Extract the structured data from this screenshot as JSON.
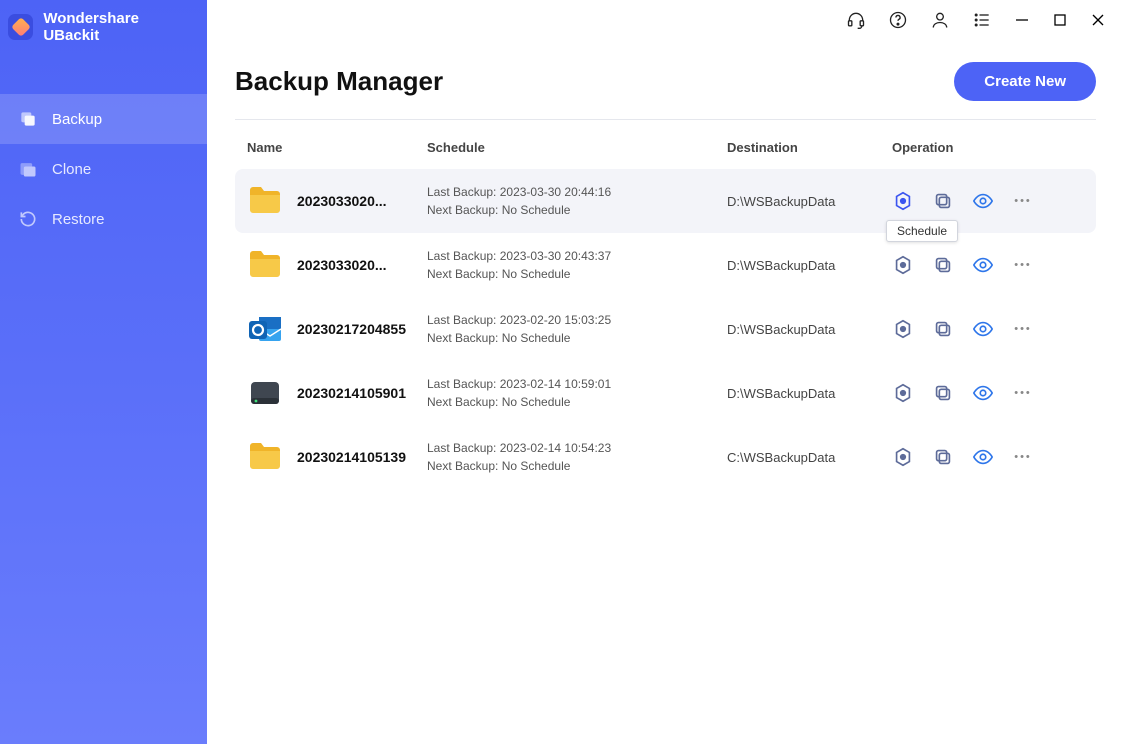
{
  "app": {
    "title": "Wondershare UBackit"
  },
  "sidebar": {
    "items": [
      {
        "label": "Backup",
        "icon": "backup-icon",
        "active": true
      },
      {
        "label": "Clone",
        "icon": "clone-icon",
        "active": false
      },
      {
        "label": "Restore",
        "icon": "restore-icon",
        "active": false
      }
    ]
  },
  "titlebar": {
    "icons": [
      "headset-icon",
      "help-icon",
      "user-icon",
      "menu-icon"
    ],
    "window": [
      "minimize",
      "maximize",
      "close"
    ]
  },
  "main": {
    "title": "Backup Manager",
    "create_label": "Create New",
    "columns": {
      "name": "Name",
      "schedule": "Schedule",
      "destination": "Destination",
      "operation": "Operation"
    },
    "rows": [
      {
        "name": "2023033020...",
        "type": "folder",
        "last": "2023-03-30 20:44:16",
        "next": "No Schedule",
        "dest": "D:\\WSBackupData",
        "highlight": true,
        "tooltip": "Schedule",
        "schedule_active": true
      },
      {
        "name": "2023033020...",
        "type": "folder",
        "last": "2023-03-30 20:43:37",
        "next": "No Schedule",
        "dest": "D:\\WSBackupData"
      },
      {
        "name": "20230217204855",
        "type": "outlook",
        "last": "2023-02-20 15:03:25",
        "next": "No Schedule",
        "dest": "D:\\WSBackupData"
      },
      {
        "name": "20230214105901",
        "type": "disk",
        "last": "2023-02-14 10:59:01",
        "next": "No Schedule",
        "dest": "D:\\WSBackupData"
      },
      {
        "name": "20230214105139",
        "type": "folder",
        "last": "2023-02-14 10:54:23",
        "next": "No Schedule",
        "dest": "C:\\WSBackupData"
      }
    ],
    "ops_tooltip": "Schedule"
  }
}
